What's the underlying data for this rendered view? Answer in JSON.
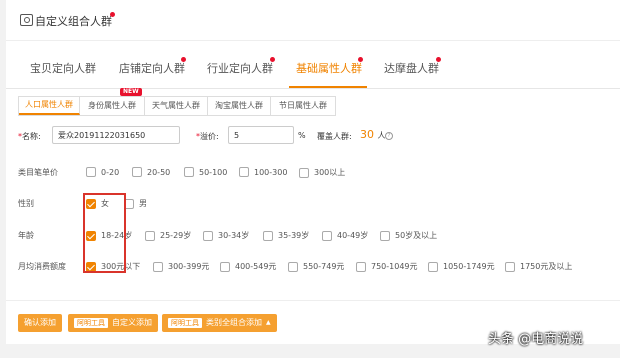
{
  "header": {
    "title": "自定义组合人群"
  },
  "main_tabs": [
    {
      "label": "宝贝定向人群",
      "active": false,
      "dot": false
    },
    {
      "label": "店铺定向人群",
      "active": false,
      "dot": true
    },
    {
      "label": "行业定向人群",
      "active": false,
      "dot": true
    },
    {
      "label": "基础属性人群",
      "active": true,
      "dot": true
    },
    {
      "label": "达摩盘人群",
      "active": false,
      "dot": true
    }
  ],
  "sub_tabs": [
    {
      "label": "人口属性人群",
      "active": true
    },
    {
      "label": "身份属性人群",
      "active": false,
      "badge": "NEW"
    },
    {
      "label": "天气属性人群",
      "active": false
    },
    {
      "label": "淘宝属性人群",
      "active": false
    },
    {
      "label": "节日属性人群",
      "active": false
    }
  ],
  "form": {
    "name_label": "名称:",
    "name_value": "爱众20191122031650",
    "premium_label": "溢价:",
    "premium_value": "5",
    "premium_unit": "%",
    "coverage_label": "覆盖人群:",
    "coverage_value": "30",
    "coverage_unit": "人",
    "help_icon": "?"
  },
  "rows": {
    "price": {
      "label": "类目笔单价",
      "options": [
        {
          "label": "0-20",
          "checked": false
        },
        {
          "label": "20-50",
          "checked": false
        },
        {
          "label": "50-100",
          "checked": false
        },
        {
          "label": "100-300",
          "checked": false
        },
        {
          "label": "300以上",
          "checked": false
        }
      ]
    },
    "gender": {
      "label": "性别",
      "options": [
        {
          "label": "女",
          "checked": true
        },
        {
          "label": "男",
          "checked": false
        }
      ]
    },
    "age": {
      "label": "年龄",
      "options": [
        {
          "label": "18-24岁",
          "checked": true
        },
        {
          "label": "25-29岁",
          "checked": false
        },
        {
          "label": "30-34岁",
          "checked": false
        },
        {
          "label": "35-39岁",
          "checked": false
        },
        {
          "label": "40-49岁",
          "checked": false
        },
        {
          "label": "50岁及以上",
          "checked": false
        }
      ]
    },
    "spend": {
      "label": "月均消费额度",
      "options": [
        {
          "label": "300元以下",
          "checked": true
        },
        {
          "label": "300-399元",
          "checked": false
        },
        {
          "label": "400-549元",
          "checked": false
        },
        {
          "label": "550-749元",
          "checked": false
        },
        {
          "label": "750-1049元",
          "checked": false
        },
        {
          "label": "1050-1749元",
          "checked": false
        },
        {
          "label": "1750元及以上",
          "checked": false
        }
      ]
    }
  },
  "buttons": {
    "confirm": "确认添加",
    "custom_tag": "阿明工具",
    "custom_label": "自定义添加",
    "category_tag": "阿明工具",
    "category_label": "类别全组合添加",
    "caret": "▲"
  },
  "watermark": "头条 @电商说说",
  "colors": {
    "accent": "#f08300",
    "red_dot": "#e8112d",
    "highlight_box": "#d9342b"
  }
}
